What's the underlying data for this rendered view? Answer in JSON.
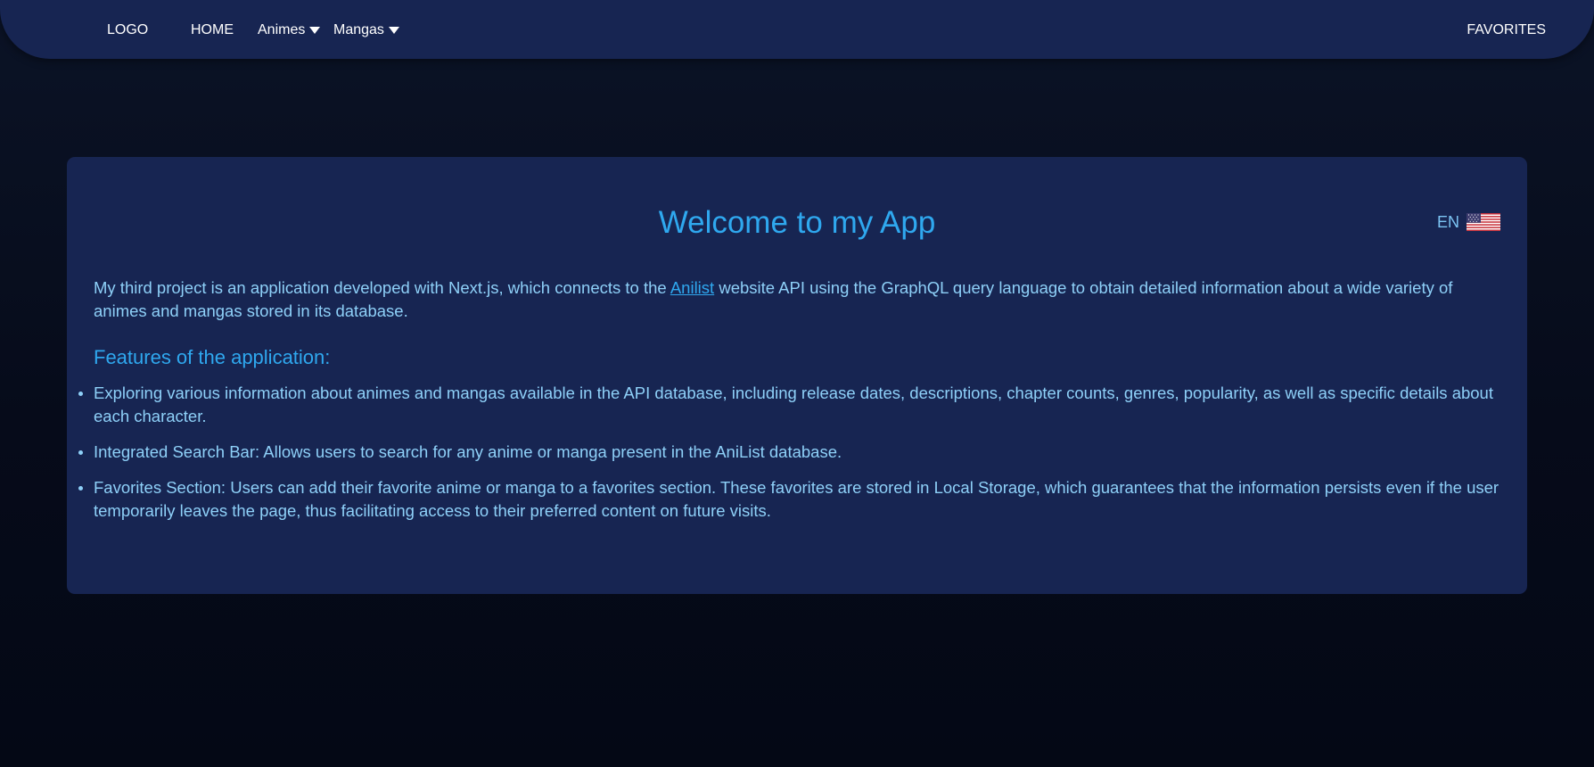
{
  "nav": {
    "logo": "LOGO",
    "home": "HOME",
    "animes": "Animes",
    "mangas": "Mangas",
    "favorites": "FAVORITES",
    "dropdown_icon": "caret-down-icon"
  },
  "main": {
    "title": "Welcome to my App",
    "language": {
      "code": "EN",
      "icon": "us-flag-icon"
    },
    "intro": {
      "before_link": "My third project is an application developed with Next.js, which connects to the ",
      "link_text": "Anilist",
      "after_link": " website API using the GraphQL query language to obtain detailed information about a wide variety of animes and mangas stored in its database."
    },
    "features_heading": "Features of the application:",
    "features": [
      "Exploring various information about animes and mangas available in the API database, including release dates, descriptions, chapter counts, genres, popularity, as well as specific details about each character.",
      "Integrated Search Bar: Allows users to search for any anime or manga present in the AniList database.",
      "Favorites Section: Users can add their favorite anime or manga to a favorites section. These favorites are stored in Local Storage, which guarantees that the information persists even if the user temporarily leaves the page, thus facilitating access to their preferred content on future visits."
    ]
  },
  "colors": {
    "page_background": "#070d1d",
    "nav_background": "#172552",
    "card_background": "#172552",
    "accent": "#2fa8ef",
    "body_text": "#8ed0f8",
    "nav_text": "#ffffff"
  }
}
